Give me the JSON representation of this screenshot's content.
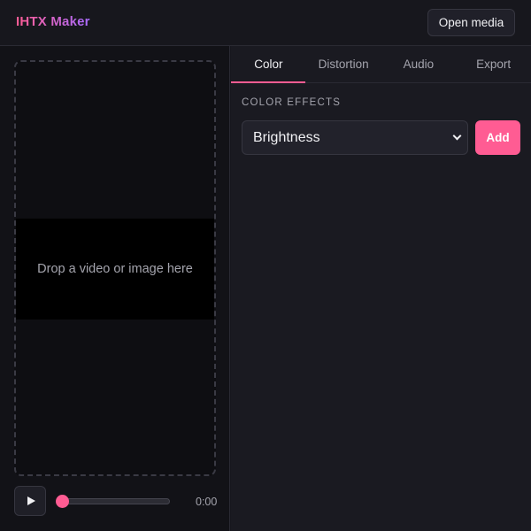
{
  "app": {
    "title": "IHTX Maker",
    "accent": "#ff5c93",
    "logo_gradient": [
      "#ff5c93",
      "#a86bff"
    ]
  },
  "header": {
    "open_media_label": "Open media"
  },
  "preview": {
    "drop_text": "Drop a video or image here",
    "play_icon": "play-icon",
    "time": "0:00",
    "seek_progress": 0
  },
  "tabs": [
    {
      "label": "Color",
      "active": true
    },
    {
      "label": "Distortion",
      "active": false
    },
    {
      "label": "Audio",
      "active": false
    },
    {
      "label": "Export",
      "active": false
    }
  ],
  "color_panel": {
    "section_title": "COLOR EFFECTS",
    "effect_select": {
      "value": "Brightness",
      "icon": "chevron-down-icon"
    },
    "add_label": "Add"
  }
}
